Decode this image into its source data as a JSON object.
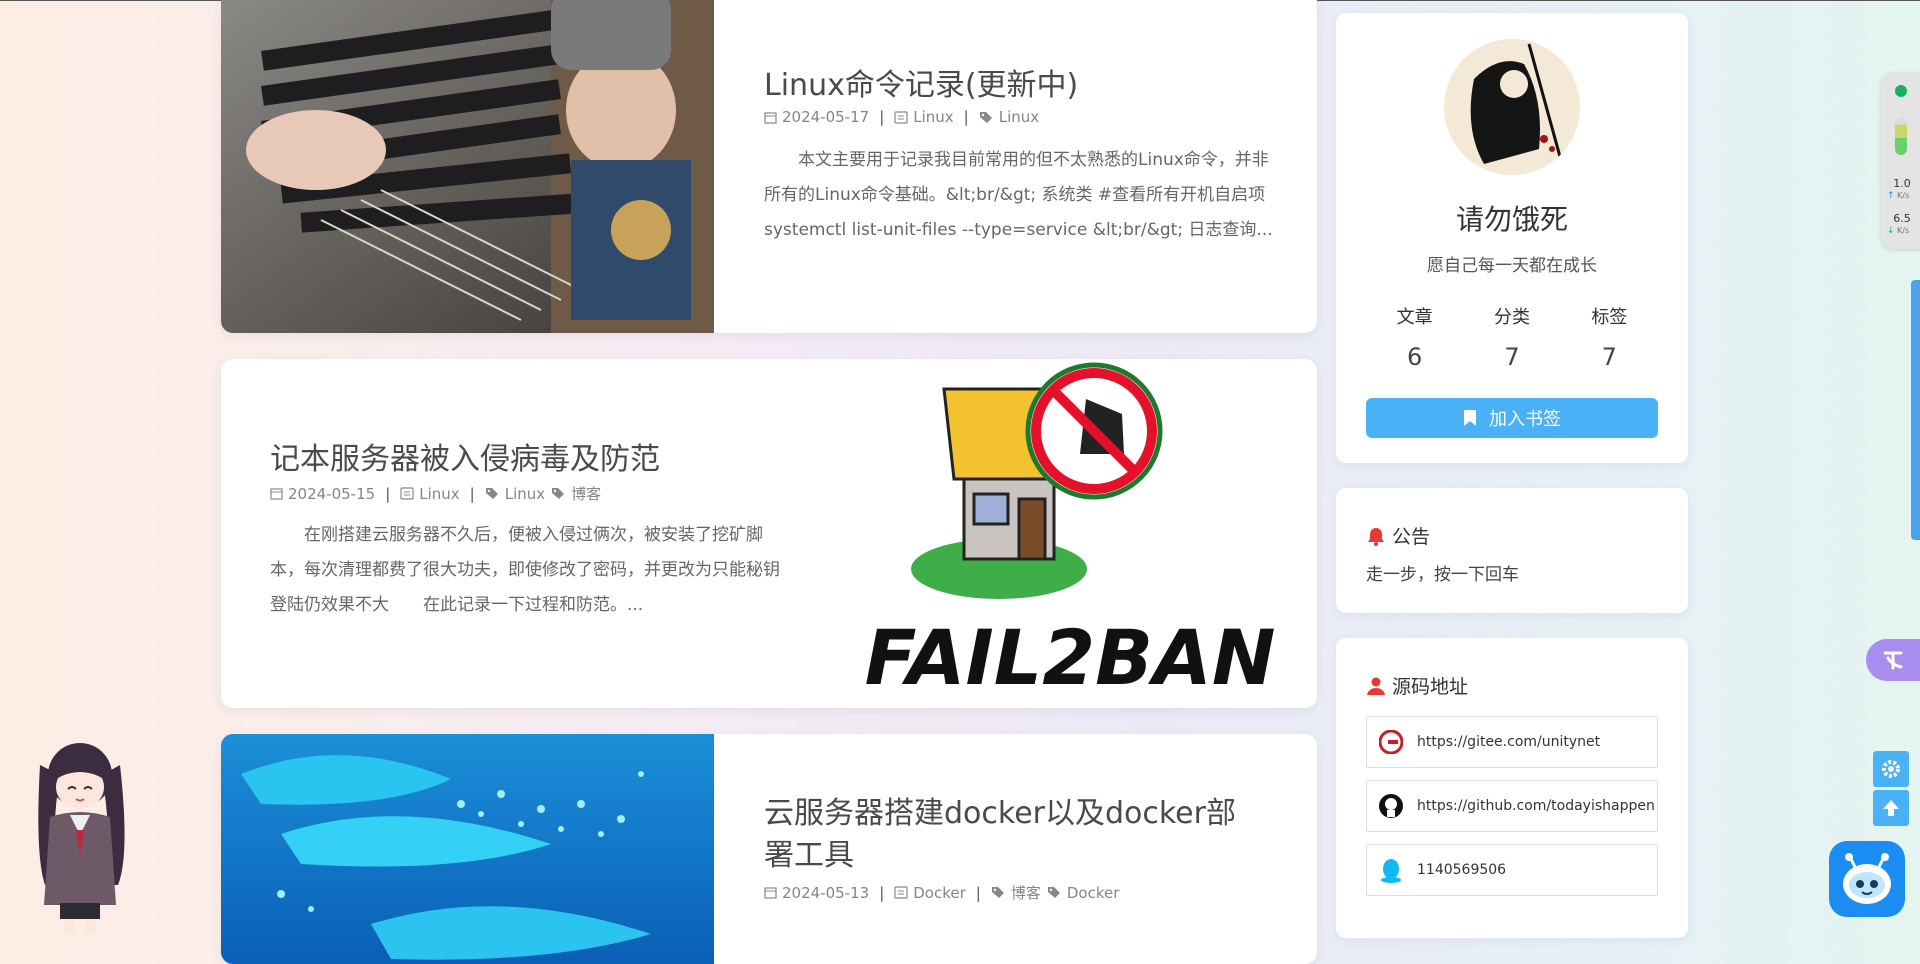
{
  "posts": [
    {
      "title": "Linux命令记录(更新中)",
      "date": "2024-05-17",
      "category": "Linux",
      "tags": [
        "Linux"
      ],
      "excerpt": "本文主要用于记录我目前常用的但不太熟悉的Linux命令，并非所有的Linux命令基础。&lt;br/&gt; 系统类 #查看所有开机自启项 systemctl list-unit-files --type=service &lt;br/&gt; 日志查询..."
    },
    {
      "title": "记本服务器被入侵病毒及防范",
      "date": "2024-05-15",
      "category": "Linux",
      "tags": [
        "Linux",
        "博客"
      ],
      "excerpt": "在刚搭建云服务器不久后，便被入侵过俩次，被安装了挖矿脚本，每次清理都费了很大功夫，即使修改了密码，并更改为只能秘钥登陆仍效果不大　　在此记录一下过程和防范。...",
      "image_text": "FAIL2BAN"
    },
    {
      "title": "云服务器搭建docker以及docker部署工具",
      "date": "2024-05-13",
      "category": "Docker",
      "tags": [
        "博客",
        "Docker"
      ],
      "excerpt": ""
    }
  ],
  "author": {
    "name": "请勿饿死",
    "description": "愿自己每一天都在成长",
    "stats": [
      {
        "label": "文章",
        "value": "6"
      },
      {
        "label": "分类",
        "value": "7"
      },
      {
        "label": "标签",
        "value": "7"
      }
    ],
    "bookmark_label": "加入书签"
  },
  "announcement": {
    "title": "公告",
    "text": "走一步，按一下回车"
  },
  "source": {
    "title": "源码地址",
    "links": [
      {
        "icon": "gitee-icon",
        "text": "https://gitee.com/unitynet"
      },
      {
        "icon": "github-icon",
        "text": "https://github.com/todayishappen"
      },
      {
        "icon": "qq-icon",
        "text": "1140569506"
      }
    ]
  },
  "net_monitor": {
    "upload_value": "1.0",
    "upload_unit": "K/s",
    "download_value": "6.5",
    "download_unit": "K/s"
  },
  "colors": {
    "accent": "#49b1f5",
    "notice_red": "#e53935"
  }
}
